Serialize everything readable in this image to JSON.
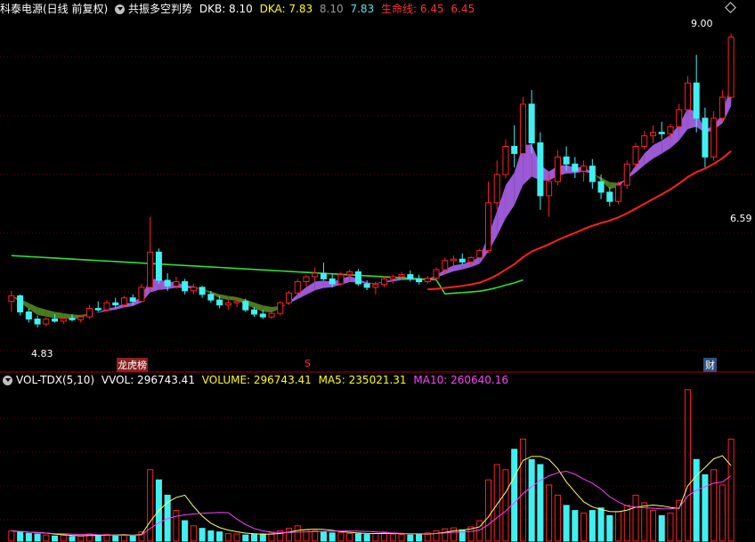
{
  "main_header": {
    "stock": "科泰电源(日线 前复权)",
    "indicator": "共振多空判势",
    "dkb_label": "DKB: 8.10",
    "dka_label": "DKA: 7.83",
    "val_gray": "8.10",
    "val_cyan": "7.83",
    "life_label": "生命线: 6.45",
    "life_val": "6.45"
  },
  "price_labels": {
    "high": "9.00",
    "low": "4.83",
    "life_right": "6.59"
  },
  "markers": [
    "龙虎榜",
    "S",
    "财"
  ],
  "vol_header": {
    "name": "VOL-TDX(5,10)",
    "vvol": "VVOL: 296743.41",
    "volume": "VOLUME: 296743.41",
    "ma5": "MA5: 235021.31",
    "ma10": "MA10: 260640.16"
  },
  "colors": {
    "up": "#ff2020",
    "down": "#40f0f0",
    "ribbon_bull": "#9b59d6",
    "ribbon_bear": "#4a7a1e",
    "life_line": "#ff2020",
    "ma60": "#30e030",
    "ma5": "#ffff60",
    "ma10": "#ff40ff"
  },
  "chart_data": {
    "type": "candlestick",
    "price_range": [
      4.4,
      9.2
    ],
    "candles": [
      [
        5.2,
        5.35,
        5.05,
        5.28
      ],
      [
        5.28,
        5.3,
        5.0,
        5.05
      ],
      [
        5.05,
        5.1,
        4.9,
        4.95
      ],
      [
        4.95,
        5.0,
        4.83,
        4.88
      ],
      [
        4.88,
        4.98,
        4.85,
        4.95
      ],
      [
        4.95,
        5.02,
        4.9,
        4.92
      ],
      [
        4.92,
        4.98,
        4.88,
        4.96
      ],
      [
        4.96,
        5.02,
        4.92,
        4.94
      ],
      [
        4.94,
        5.0,
        4.9,
        4.98
      ],
      [
        4.98,
        5.15,
        4.95,
        5.1
      ],
      [
        5.1,
        5.2,
        5.05,
        5.08
      ],
      [
        5.08,
        5.22,
        5.05,
        5.18
      ],
      [
        5.18,
        5.25,
        5.1,
        5.15
      ],
      [
        5.15,
        5.28,
        5.12,
        5.25
      ],
      [
        5.25,
        5.3,
        5.15,
        5.2
      ],
      [
        5.2,
        5.45,
        5.18,
        5.4
      ],
      [
        5.4,
        6.4,
        5.35,
        5.9
      ],
      [
        5.9,
        5.95,
        5.45,
        5.5
      ],
      [
        5.5,
        5.6,
        5.35,
        5.42
      ],
      [
        5.42,
        5.55,
        5.38,
        5.48
      ],
      [
        5.48,
        5.52,
        5.3,
        5.35
      ],
      [
        5.35,
        5.45,
        5.3,
        5.4
      ],
      [
        5.4,
        5.42,
        5.25,
        5.3
      ],
      [
        5.3,
        5.35,
        5.18,
        5.22
      ],
      [
        5.22,
        5.28,
        5.1,
        5.15
      ],
      [
        5.15,
        5.22,
        5.08,
        5.18
      ],
      [
        5.18,
        5.25,
        5.12,
        5.2
      ],
      [
        5.2,
        5.24,
        5.05,
        5.08
      ],
      [
        5.08,
        5.12,
        4.98,
        5.02
      ],
      [
        5.02,
        5.08,
        4.95,
        4.98
      ],
      [
        4.98,
        5.05,
        4.95,
        5.03
      ],
      [
        5.03,
        5.2,
        5.0,
        5.18
      ],
      [
        5.18,
        5.35,
        5.15,
        5.32
      ],
      [
        5.32,
        5.52,
        5.28,
        5.48
      ],
      [
        5.48,
        5.58,
        5.4,
        5.55
      ],
      [
        5.55,
        5.68,
        5.48,
        5.6
      ],
      [
        5.6,
        5.75,
        5.5,
        5.52
      ],
      [
        5.52,
        5.6,
        5.4,
        5.45
      ],
      [
        5.45,
        5.62,
        5.42,
        5.58
      ],
      [
        5.58,
        5.65,
        5.5,
        5.62
      ],
      [
        5.62,
        5.66,
        5.42,
        5.45
      ],
      [
        5.45,
        5.5,
        5.36,
        5.4
      ],
      [
        5.4,
        5.48,
        5.3,
        5.44
      ],
      [
        5.44,
        5.56,
        5.4,
        5.52
      ],
      [
        5.52,
        5.58,
        5.45,
        5.55
      ],
      [
        5.55,
        5.62,
        5.5,
        5.58
      ],
      [
        5.58,
        5.64,
        5.48,
        5.52
      ],
      [
        5.52,
        5.58,
        5.44,
        5.48
      ],
      [
        5.48,
        5.56,
        5.45,
        5.53
      ],
      [
        5.53,
        5.68,
        5.5,
        5.65
      ],
      [
        5.65,
        5.82,
        5.6,
        5.78
      ],
      [
        5.78,
        5.85,
        5.7,
        5.8
      ],
      [
        5.8,
        5.88,
        5.72,
        5.76
      ],
      [
        5.76,
        5.84,
        5.7,
        5.82
      ],
      [
        5.82,
        5.95,
        5.78,
        5.92
      ],
      [
        5.92,
        6.9,
        5.88,
        6.6
      ],
      [
        6.6,
        7.2,
        6.5,
        7.0
      ],
      [
        7.0,
        7.5,
        6.95,
        7.4
      ],
      [
        7.4,
        7.7,
        7.1,
        7.3
      ],
      [
        7.3,
        8.1,
        7.25,
        8.0
      ],
      [
        8.0,
        8.2,
        7.3,
        7.45
      ],
      [
        7.45,
        7.6,
        6.5,
        6.7
      ],
      [
        6.7,
        7.0,
        6.4,
        6.9
      ],
      [
        6.9,
        7.35,
        6.85,
        7.25
      ],
      [
        7.25,
        7.4,
        7.05,
        7.15
      ],
      [
        7.15,
        7.25,
        6.95,
        7.05
      ],
      [
        7.05,
        7.2,
        6.9,
        7.12
      ],
      [
        7.12,
        7.22,
        6.8,
        6.9
      ],
      [
        6.9,
        7.0,
        6.65,
        6.75
      ],
      [
        6.75,
        6.82,
        6.55,
        6.62
      ],
      [
        6.62,
        6.9,
        6.58,
        6.85
      ],
      [
        6.85,
        7.2,
        6.8,
        7.15
      ],
      [
        7.15,
        7.45,
        7.1,
        7.4
      ],
      [
        7.4,
        7.62,
        7.35,
        7.55
      ],
      [
        7.55,
        7.7,
        7.45,
        7.6
      ],
      [
        7.6,
        7.75,
        7.5,
        7.58
      ],
      [
        7.58,
        7.72,
        7.5,
        7.68
      ],
      [
        7.68,
        8.0,
        7.65,
        7.92
      ],
      [
        7.92,
        8.4,
        7.85,
        8.3
      ],
      [
        8.3,
        8.7,
        7.6,
        7.8
      ],
      [
        7.8,
        7.95,
        7.1,
        7.25
      ],
      [
        7.25,
        7.9,
        7.2,
        7.8
      ],
      [
        7.8,
        8.2,
        7.75,
        8.1
      ],
      [
        8.1,
        9.0,
        8.05,
        8.95
      ]
    ],
    "volume_range": [
      0,
      300000
    ],
    "volumes": [
      [
        20000,
        1
      ],
      [
        18000,
        0
      ],
      [
        15000,
        0
      ],
      [
        14000,
        0
      ],
      [
        12000,
        1
      ],
      [
        10000,
        0
      ],
      [
        11000,
        1
      ],
      [
        9000,
        0
      ],
      [
        10000,
        1
      ],
      [
        14000,
        1
      ],
      [
        12000,
        0
      ],
      [
        13000,
        1
      ],
      [
        11000,
        0
      ],
      [
        12000,
        1
      ],
      [
        10000,
        0
      ],
      [
        18000,
        1
      ],
      [
        140000,
        1
      ],
      [
        120000,
        0
      ],
      [
        90000,
        0
      ],
      [
        60000,
        1
      ],
      [
        40000,
        0
      ],
      [
        30000,
        1
      ],
      [
        25000,
        0
      ],
      [
        20000,
        0
      ],
      [
        18000,
        0
      ],
      [
        15000,
        1
      ],
      [
        14000,
        1
      ],
      [
        12000,
        0
      ],
      [
        13000,
        0
      ],
      [
        14000,
        0
      ],
      [
        16000,
        1
      ],
      [
        20000,
        1
      ],
      [
        25000,
        1
      ],
      [
        30000,
        1
      ],
      [
        22000,
        1
      ],
      [
        20000,
        1
      ],
      [
        18000,
        0
      ],
      [
        16000,
        0
      ],
      [
        17000,
        1
      ],
      [
        15000,
        1
      ],
      [
        14000,
        0
      ],
      [
        13000,
        0
      ],
      [
        15000,
        1
      ],
      [
        18000,
        1
      ],
      [
        14000,
        1
      ],
      [
        13000,
        1
      ],
      [
        12000,
        0
      ],
      [
        14000,
        0
      ],
      [
        16000,
        1
      ],
      [
        20000,
        1
      ],
      [
        24000,
        1
      ],
      [
        26000,
        1
      ],
      [
        22000,
        0
      ],
      [
        28000,
        1
      ],
      [
        40000,
        1
      ],
      [
        120000,
        1
      ],
      [
        150000,
        1
      ],
      [
        140000,
        1
      ],
      [
        180000,
        0
      ],
      [
        200000,
        1
      ],
      [
        160000,
        0
      ],
      [
        150000,
        0
      ],
      [
        110000,
        1
      ],
      [
        90000,
        1
      ],
      [
        70000,
        0
      ],
      [
        60000,
        0
      ],
      [
        55000,
        1
      ],
      [
        60000,
        0
      ],
      [
        65000,
        0
      ],
      [
        50000,
        0
      ],
      [
        58000,
        1
      ],
      [
        70000,
        1
      ],
      [
        90000,
        1
      ],
      [
        75000,
        1
      ],
      [
        60000,
        1
      ],
      [
        50000,
        0
      ],
      [
        55000,
        1
      ],
      [
        80000,
        1
      ],
      [
        296743,
        1
      ],
      [
        160000,
        0
      ],
      [
        130000,
        0
      ],
      [
        140000,
        1
      ],
      [
        110000,
        1
      ],
      [
        200000,
        1
      ]
    ]
  }
}
